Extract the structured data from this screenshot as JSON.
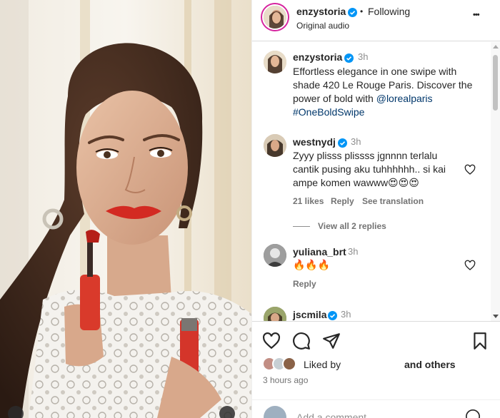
{
  "header": {
    "username": "enzystoria",
    "separator": "•",
    "follow_state": "Following",
    "audio": "Original audio",
    "more": "•••"
  },
  "caption": {
    "username": "enzystoria",
    "time": "3h",
    "text_before": "Effortless elegance in one swipe with shade 420 Le Rouge Paris. Discover the power of bold with ",
    "mention": "@lorealparis",
    "hashtag": "#OneBoldSwipe"
  },
  "comments": [
    {
      "username": "westnydj",
      "verified": true,
      "time": "3h",
      "text": "Zyyy plisss plissss jgnnnn terlalu cantik pusing aku tuhhhhhh.. si kai ampe komen wawww😍😍😍",
      "likes": "21 likes",
      "reply": "Reply",
      "translate": "See translation",
      "view_replies": "View all 2 replies"
    },
    {
      "username": "yuliana_brt",
      "verified": false,
      "time": "3h",
      "text": "🔥🔥🔥",
      "reply": "Reply"
    },
    {
      "username": "jscmila",
      "verified": true,
      "time": "3h"
    }
  ],
  "footer": {
    "liked_by_label": "Liked by",
    "and_others": "and others",
    "timestamp": "3 hours ago",
    "add_comment_placeholder": "Add a comment..."
  },
  "colors": {
    "verified": "#0095f6",
    "link": "#00376b",
    "lipstick": "#d93a2b",
    "muted": "#737373"
  }
}
